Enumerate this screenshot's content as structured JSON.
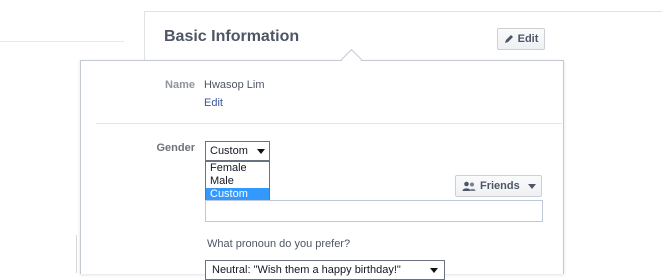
{
  "section": {
    "title": "Basic Information",
    "edit_button": "Edit"
  },
  "name_row": {
    "label": "Name",
    "value": "Hwasop Lim",
    "edit_link": "Edit"
  },
  "gender_row": {
    "label": "Gender",
    "selected": "Custom",
    "options": [
      "Female",
      "Male",
      "Custom"
    ],
    "highlighted_option": "Custom"
  },
  "audience_button": {
    "label": "Friends",
    "icon": "people-icon"
  },
  "custom_gender_input": {
    "value": ""
  },
  "pronoun": {
    "question": "What pronoun do you prefer?",
    "selected": "Neutral: \"Wish them a happy birthday!\""
  },
  "colors": {
    "link": "#3b5998",
    "highlight": "#3399ff"
  }
}
